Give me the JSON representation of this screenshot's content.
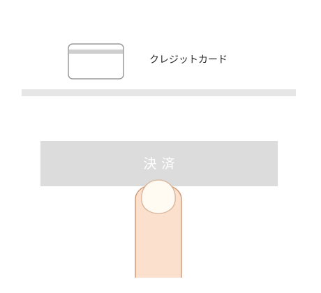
{
  "payment_option": {
    "label": "クレジットカード",
    "icon": "credit-card-icon"
  },
  "pay_button": {
    "label": "決済"
  },
  "pointer": {
    "icon": "finger-tap-icon"
  },
  "colors": {
    "button_background": "#dcdcdc",
    "divider": "#e6e6e6",
    "finger_skin": "#fbe0cd",
    "finger_outline": "#cc9068",
    "fingernail": "#fffaf2"
  }
}
